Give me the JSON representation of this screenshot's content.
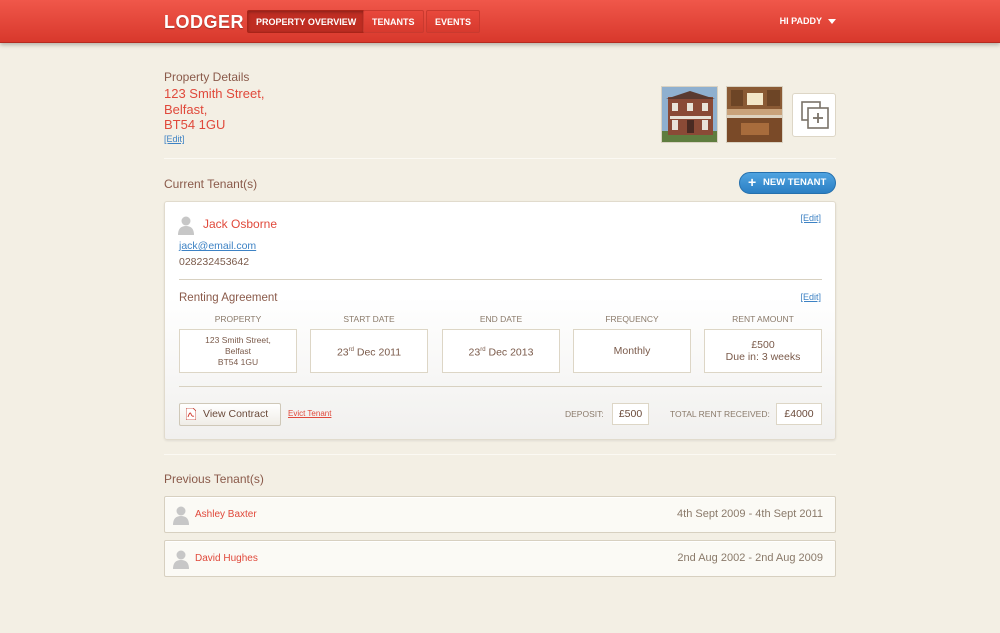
{
  "header": {
    "logo": "LODGER",
    "nav": [
      {
        "label": "Property Overview",
        "active": true
      },
      {
        "label": "Tenants",
        "active": false
      },
      {
        "label": "Events",
        "active": false
      }
    ],
    "user_greeting": "HI PADDY"
  },
  "property": {
    "heading": "Property Details",
    "address_line1": "123 Smith Street,",
    "address_line2": "Belfast,",
    "address_line3": "BT54 1GU",
    "edit_label": "[Edit]",
    "photos": [
      "house-exterior-photo",
      "kitchen-interior-photo"
    ],
    "add_photo_icon": "add-photo-icon"
  },
  "current_tenants": {
    "title": "Current Tenant(s)",
    "new_tenant_label": "NEW TENANT",
    "tenant": {
      "name": "Jack Osborne",
      "email": "jack@email.com",
      "phone": "028232453642",
      "edit_label": "[Edit]"
    },
    "agreement": {
      "title": "Renting Agreement",
      "edit_label": "[Edit]",
      "fields": {
        "property_label": "PROPERTY",
        "property_l1": "123 Smith Street,",
        "property_l2": "Belfast",
        "property_l3": "BT54 1GU",
        "start_label": "START DATE",
        "start_day": "23",
        "start_suffix": "rd",
        "start_rest": " Dec 2011",
        "end_label": "END DATE",
        "end_day": "23",
        "end_suffix": "rd",
        "end_rest": " Dec 2013",
        "frequency_label": "FREQUENCY",
        "frequency_value": "Monthly",
        "rent_label": "RENT AMOUNT",
        "rent_value": "£500",
        "rent_due": "Due in: 3 weeks"
      },
      "view_contract_label": "View Contract",
      "evict_label": "Evict Tenant",
      "deposit_label": "DEPOSIT:",
      "deposit_value": "£500",
      "total_label": "TOTAL RENT RECEIVED:",
      "total_value": "£4000"
    }
  },
  "previous_tenants": {
    "title": "Previous Tenant(s)",
    "rows": [
      {
        "name": "Ashley Baxter",
        "dates": "4th Sept 2009 - 4th Sept 2011"
      },
      {
        "name": "David Hughes",
        "dates": "2nd Aug 2002 - 2nd Aug 2009"
      }
    ]
  },
  "colors": {
    "header_red": "#e0493b",
    "accent_blue": "#2b7fc4",
    "background": "#f3efe4"
  }
}
